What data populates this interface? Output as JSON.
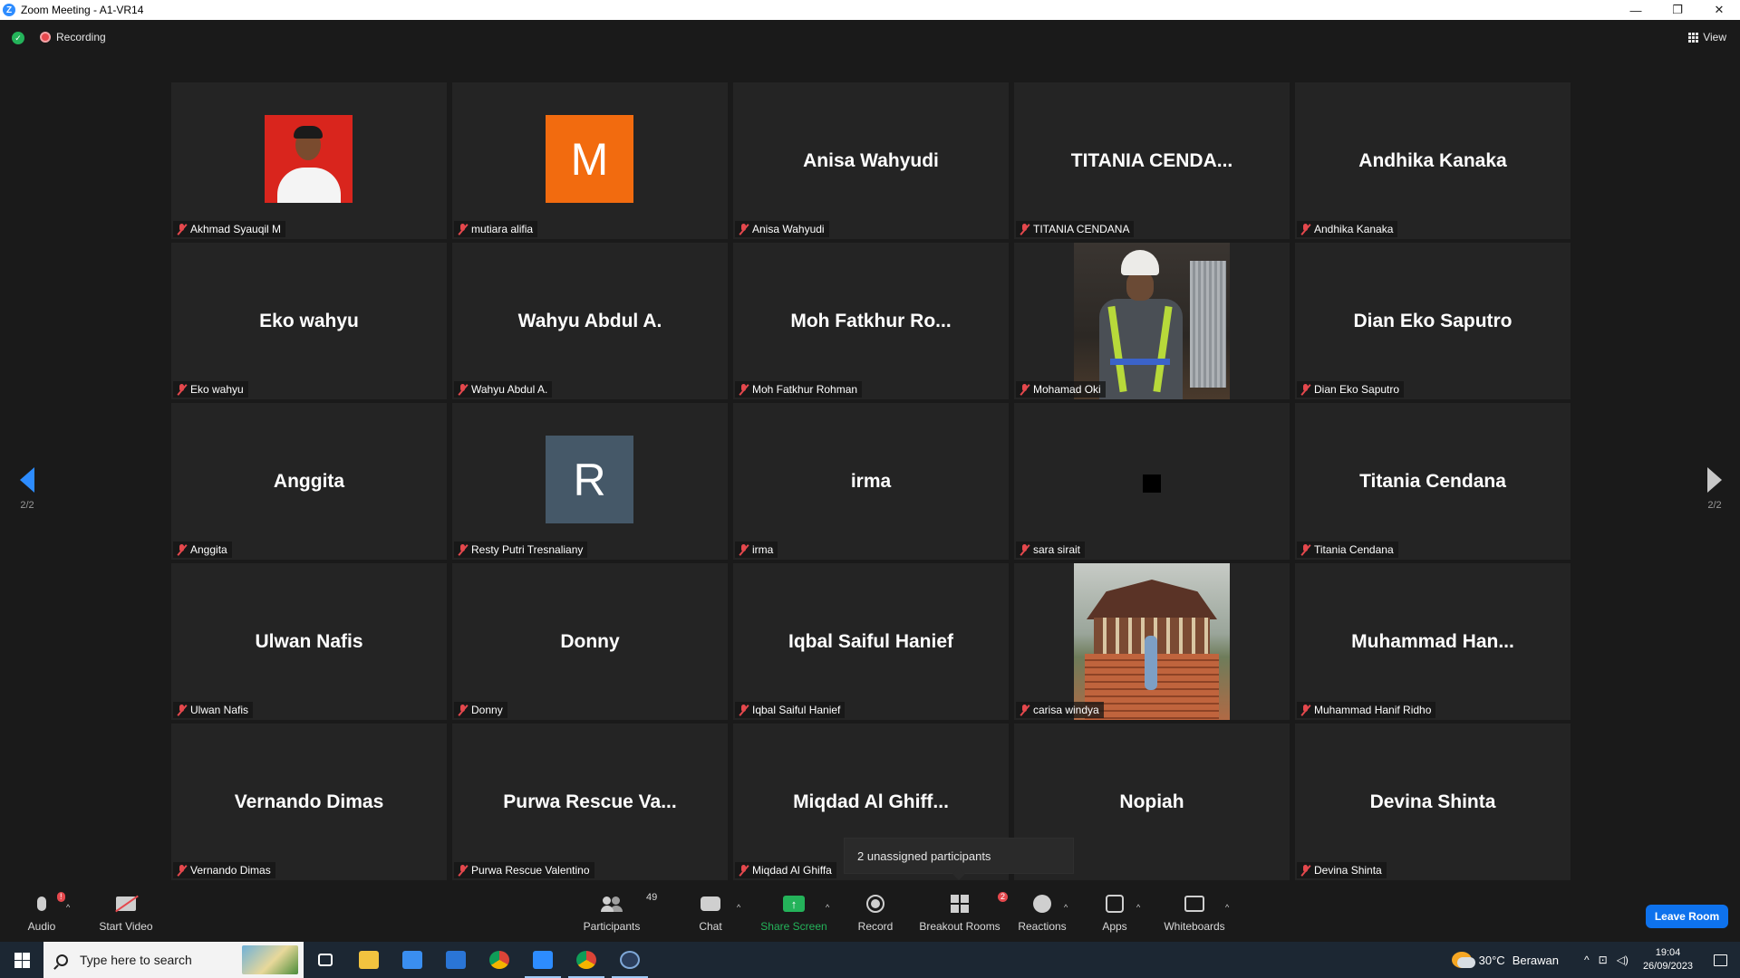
{
  "window": {
    "title": "Zoom Meeting - A1-VR14",
    "app_icon_letter": "Z",
    "minimize": "—",
    "restore": "❐",
    "close": "✕"
  },
  "topbar": {
    "recording_label": "Recording",
    "view_label": "View"
  },
  "tiles": [
    {
      "name_tag": "Akhmad Syauqil M",
      "display": "",
      "type": "photo"
    },
    {
      "name_tag": "mutiara alifia",
      "display": "M",
      "type": "letter",
      "color": "#f26b0f"
    },
    {
      "name_tag": "Anisa Wahyudi",
      "display": "Anisa Wahyudi",
      "type": "name"
    },
    {
      "name_tag": "TITANIA CENDANA",
      "display": "TITANIA  CENDA...",
      "type": "name"
    },
    {
      "name_tag": "Andhika Kanaka",
      "display": "Andhika Kanaka",
      "type": "name"
    },
    {
      "name_tag": "Eko wahyu",
      "display": "Eko wahyu",
      "type": "name"
    },
    {
      "name_tag": "Wahyu Abdul A.",
      "display": "Wahyu Abdul A.",
      "type": "name"
    },
    {
      "name_tag": "Moh Fatkhur Rohman",
      "display": "Moh  Fatkhur  Ro...",
      "type": "name"
    },
    {
      "name_tag": "Mohamad Oki",
      "display": "",
      "type": "video-worker"
    },
    {
      "name_tag": "Dian Eko Saputro",
      "display": "Dian Eko Saputro",
      "type": "name"
    },
    {
      "name_tag": "Anggita",
      "display": "Anggita",
      "type": "name"
    },
    {
      "name_tag": "Resty Putri Tresnaliany",
      "display": "R",
      "type": "letter",
      "color": "#455868"
    },
    {
      "name_tag": "irma",
      "display": "irma",
      "type": "name"
    },
    {
      "name_tag": "sara sirait",
      "display": "",
      "type": "square"
    },
    {
      "name_tag": "Titania Cendana",
      "display": "Titania Cendana",
      "type": "name"
    },
    {
      "name_tag": "Ulwan Nafis",
      "display": "Ulwan Nafis",
      "type": "name"
    },
    {
      "name_tag": "Donny",
      "display": "Donny",
      "type": "name"
    },
    {
      "name_tag": "Iqbal Saiful Hanief",
      "display": "Iqbal Saiful Hanief",
      "type": "name"
    },
    {
      "name_tag": "carisa windya",
      "display": "",
      "type": "video-pavilion"
    },
    {
      "name_tag": "Muhammad Hanif Ridho",
      "display": "Muhammad  Han...",
      "type": "name"
    },
    {
      "name_tag": "Vernando Dimas",
      "display": "Vernando Dimas",
      "type": "name"
    },
    {
      "name_tag": "Purwa Rescue Valentino",
      "display": "Purwa  Rescue  Va...",
      "type": "name"
    },
    {
      "name_tag": "Miqdad Al Ghiffa",
      "display": "Miqdad  Al  Ghiff...",
      "type": "name"
    },
    {
      "name_tag": "",
      "display": "Nopiah",
      "type": "name"
    },
    {
      "name_tag": "Devina Shinta",
      "display": "Devina Shinta",
      "type": "name"
    }
  ],
  "paging": {
    "left": "2/2",
    "right": "2/2"
  },
  "tooltip": "2 unassigned participants",
  "toolbar": {
    "audio": "Audio",
    "audio_badge": "!",
    "start_video": "Start Video",
    "participants": "Participants",
    "participants_count": "49",
    "chat": "Chat",
    "share_screen": "Share Screen",
    "share_arrow": "↑",
    "record": "Record",
    "breakout_rooms": "Breakout Rooms",
    "breakout_badge": "2",
    "reactions": "Reactions",
    "apps": "Apps",
    "whiteboards": "Whiteboards",
    "caret": "^",
    "leave_room": "Leave Room"
  },
  "taskbar": {
    "search_placeholder": "Type here to search",
    "weather_temp": "30°C",
    "weather_text": "Berawan",
    "tray_up": "^",
    "network": "⊡",
    "volume": "◁)",
    "time": "19:04",
    "date": "26/09/2023"
  },
  "colors": {
    "accent": "#2d8cff",
    "leave": "#0e72ed",
    "share": "#24b35a",
    "muted": "#e5484d"
  }
}
